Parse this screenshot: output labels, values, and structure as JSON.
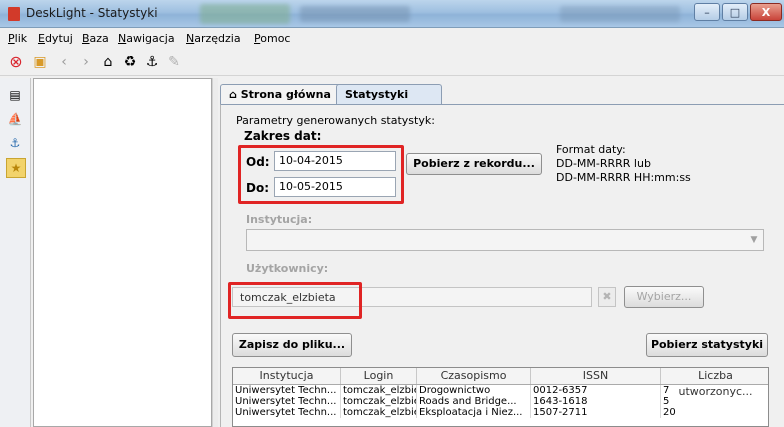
{
  "window": {
    "title": "DeskLight - Statystyki",
    "controls": {
      "minimize": "–",
      "maximize": "□",
      "close": "X"
    }
  },
  "menu": [
    {
      "first": "P",
      "rest": "lik"
    },
    {
      "first": "E",
      "rest": "dytuj"
    },
    {
      "first": "B",
      "rest": "aza"
    },
    {
      "first": "N",
      "rest": "awigacja"
    },
    {
      "first": "N",
      "rest": "arzędzia"
    },
    {
      "first": "P",
      "rest": "omoc"
    }
  ],
  "tabs": [
    {
      "label": "Strona główna"
    },
    {
      "label": "Statystyki"
    }
  ],
  "form": {
    "section_title": "Parametry generowanych statystyk:",
    "date_range_label": "Zakres dat:",
    "from_label": "Od:",
    "from_value": "10-04-2015",
    "to_label": "Do:",
    "to_value": "10-05-2015",
    "fetch_from_record_button": "Pobierz z rekordu...",
    "date_format_line1": "Format daty:",
    "date_format_line2": "DD-MM-RRRR lub",
    "date_format_line3": "DD-MM-RRRR HH:mm:ss",
    "institution_label": "Instytucja:",
    "institution_value": "",
    "users_label": "Użytkownicy:",
    "users_value": "tomczak_elzbieta",
    "choose_button": "Wybierz...",
    "save_button": "Zapisz do pliku...",
    "get_stats_button": "Pobierz statystyki"
  },
  "table": {
    "headers": [
      "Instytucja",
      "Login",
      "Czasopismo",
      "ISSN",
      "Liczba utworzonyc..."
    ],
    "rows": [
      [
        "Uniwersytet Techn...",
        "tomczak_elzbieta",
        "Drogownictwo",
        "0012-6357",
        "7"
      ],
      [
        "Uniwersytet Techn...",
        "tomczak_elzbieta",
        "Roads and Bridge...",
        "1643-1618",
        "5"
      ],
      [
        "Uniwersytet Techn...",
        "tomczak_elzbieta",
        "Eksploatacja i Niez...",
        "1507-2711",
        "20"
      ]
    ]
  },
  "colors": {
    "highlight_box": "#e02424",
    "accent": "#8fb3d8"
  }
}
